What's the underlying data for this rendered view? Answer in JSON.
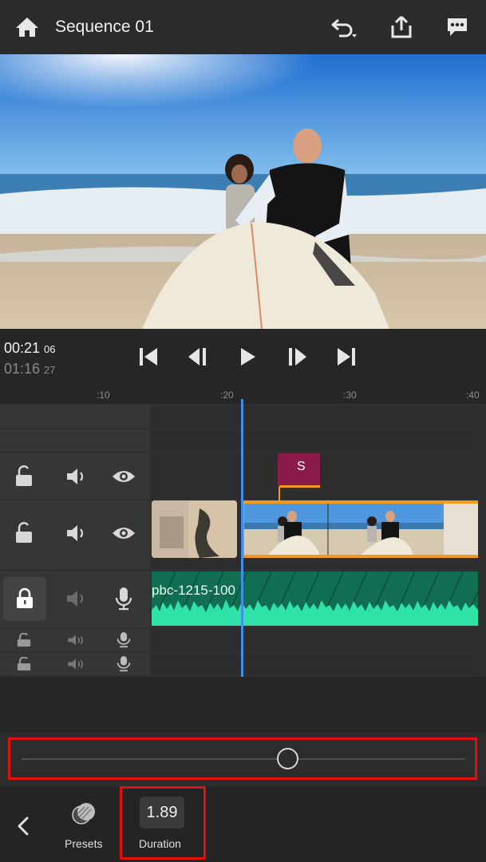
{
  "header": {
    "title": "Sequence 01",
    "icons": [
      "home-icon",
      "undo-icon",
      "share-icon",
      "feedback-icon"
    ]
  },
  "transport": {
    "current_time": "00:21",
    "current_frames": "06",
    "total_time": "01:16",
    "total_frames": "27",
    "buttons": [
      "go-to-start",
      "step-back",
      "play",
      "step-forward",
      "go-to-end"
    ]
  },
  "ruler": {
    "ticks": [
      ":10",
      ":20",
      ":30",
      ":40"
    ]
  },
  "timeline": {
    "marker_label": "S",
    "audio_clip_name": "pbc-1215-100"
  },
  "controls": {
    "slider_value": 0.6,
    "presets_label": "Presets",
    "duration_value": "1.89",
    "duration_label": "Duration"
  },
  "colors": {
    "accent_orange": "#f29a1a",
    "playhead_blue": "#3d8df5",
    "marker_magenta": "#8c1b4c",
    "audio_green": "#116e52",
    "highlight_red": "#e01010"
  }
}
